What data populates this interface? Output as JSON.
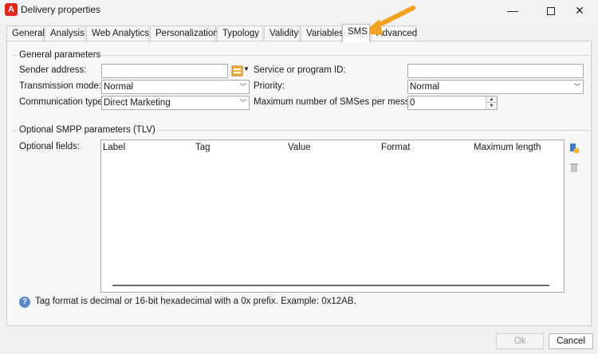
{
  "window": {
    "app_icon": "adobe-icon",
    "title": "Delivery properties",
    "controls": {
      "minimize": "—",
      "close": "✕"
    }
  },
  "tabs": [
    {
      "label": "General",
      "active": false
    },
    {
      "label": "Analysis",
      "active": false
    },
    {
      "label": "Web Analytics",
      "active": false
    },
    {
      "label": "Personalization",
      "active": false
    },
    {
      "label": "Typology",
      "active": false
    },
    {
      "label": "Validity",
      "active": false
    },
    {
      "label": "Variables",
      "active": false
    },
    {
      "label": "SMS",
      "active": true
    },
    {
      "label": "Advanced",
      "active": false
    }
  ],
  "general_parameters": {
    "legend": "General parameters",
    "sender_address": {
      "label": "Sender address:",
      "value": ""
    },
    "transmission_mode": {
      "label": "Transmission mode:",
      "value": "Normal"
    },
    "communication_type": {
      "label": "Communication type:",
      "value": "Direct Marketing"
    },
    "service_id": {
      "label": "Service or program ID:",
      "value": ""
    },
    "priority": {
      "label": "Priority:",
      "value": "Normal"
    },
    "max_sms": {
      "label": "Maximum number of SMSes per message:",
      "value": "0"
    }
  },
  "optional_smpp": {
    "legend": "Optional SMPP parameters (TLV)",
    "fields_label": "Optional fields:",
    "columns": [
      "Label",
      "Tag",
      "Value",
      "Format",
      "Maximum length"
    ],
    "rows": []
  },
  "help_text": "Tag format is decimal or 16-bit hexadecimal with a 0x prefix. Example: 0x12AB.",
  "buttons": {
    "ok": "Ok",
    "cancel": "Cancel"
  },
  "colors": {
    "annotation_arrow": "#f0a321",
    "help_icon": "#5b87c7",
    "app_icon": "#e1251b"
  }
}
